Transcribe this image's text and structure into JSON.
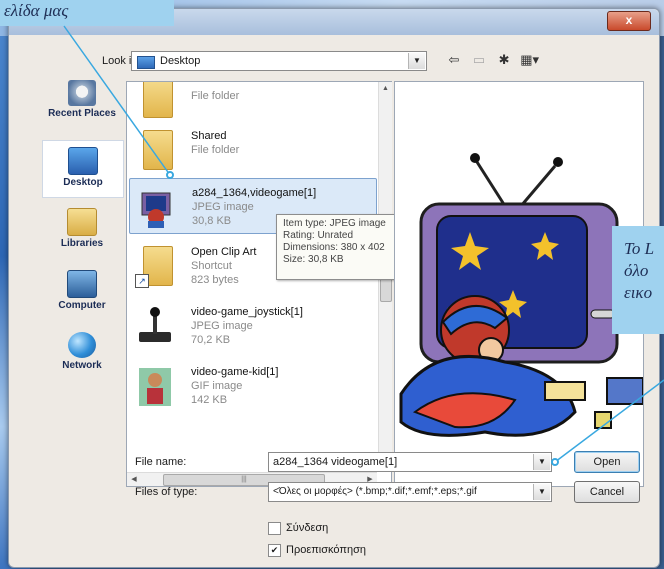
{
  "window": {
    "close_glyph": "x"
  },
  "lookin": {
    "label": "Look in:",
    "value": "Desktop"
  },
  "places": [
    {
      "label": "Recent Places"
    },
    {
      "label": "Desktop"
    },
    {
      "label": "Libraries"
    },
    {
      "label": "Computer"
    },
    {
      "label": "Network"
    }
  ],
  "files": [
    {
      "name": "",
      "type": "File folder",
      "size": ""
    },
    {
      "name": "Shared",
      "type": "File folder",
      "size": ""
    },
    {
      "name": "a284_1364,videogame[1]",
      "type": "JPEG image",
      "size": "30,8 KB"
    },
    {
      "name": "Open Clip Art",
      "type": "Shortcut",
      "size": "823 bytes"
    },
    {
      "name": "video-game_joystick[1]",
      "type": "JPEG image",
      "size": "70,2 KB"
    },
    {
      "name": "video-game-kid[1]",
      "type": "GIF image",
      "size": "142 KB"
    }
  ],
  "tooltip": {
    "item_type": "Item type: JPEG image",
    "rating": "Rating: Unrated",
    "dimensions": "Dimensions: 380 x 402",
    "size": "Size: 30,8 KB"
  },
  "filename": {
    "label": "File name:",
    "value": "a284_1364 videogame[1]"
  },
  "filetype": {
    "label": "Files of type:",
    "value": "<Όλες οι μορφές> (*.bmp;*.dif;*.emf;*.eps;*.gif"
  },
  "buttons": {
    "open": "Open",
    "cancel": "Cancel"
  },
  "options": {
    "link": {
      "label": "Σύνδεση",
      "checked": false
    },
    "preview": {
      "label": "Προεπισκόπηση",
      "checked": true
    }
  },
  "callouts": {
    "top": "ελίδα μας",
    "right_line1": "Το L",
    "right_line2": "όλο",
    "right_line3": "εικο"
  },
  "colors": {
    "callout": "#9fd2ef",
    "accent_line": "#39a8e0",
    "selection": "#dbe9f8"
  }
}
